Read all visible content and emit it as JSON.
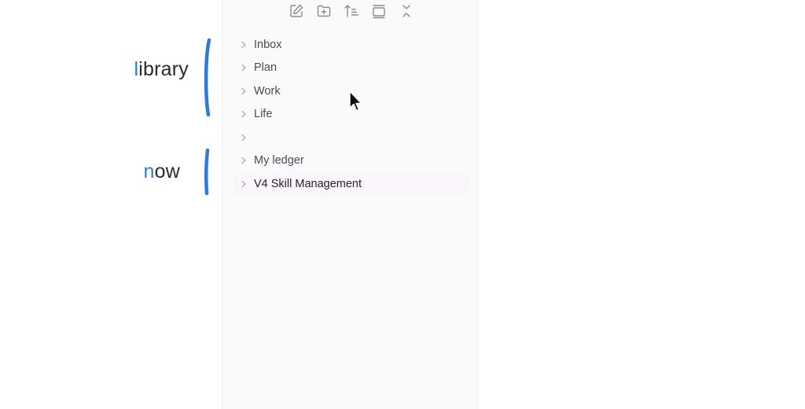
{
  "annotations": {
    "library": {
      "accent": "l",
      "rest": "ibrary"
    },
    "now": {
      "accent": "n",
      "rest": "ow"
    },
    "accent_color": "#2f7ad9"
  },
  "toolbar": {
    "new_note_icon": "edit-icon",
    "new_folder_icon": "folder-plus-icon",
    "sort_icon": "sort-icon",
    "collapse_icon": "window-icon",
    "close_icon": "collapse-all-icon"
  },
  "tree": {
    "items": [
      {
        "label": "Inbox"
      },
      {
        "label": "Plan"
      },
      {
        "label": "Work"
      },
      {
        "label": "Life"
      },
      {
        "label": ""
      },
      {
        "label": "My ledger"
      },
      {
        "label": "V4 Skill Management"
      }
    ]
  },
  "colors": {
    "panel_bg": "#fafafb",
    "highlight_bg": "#fbf5fc"
  }
}
